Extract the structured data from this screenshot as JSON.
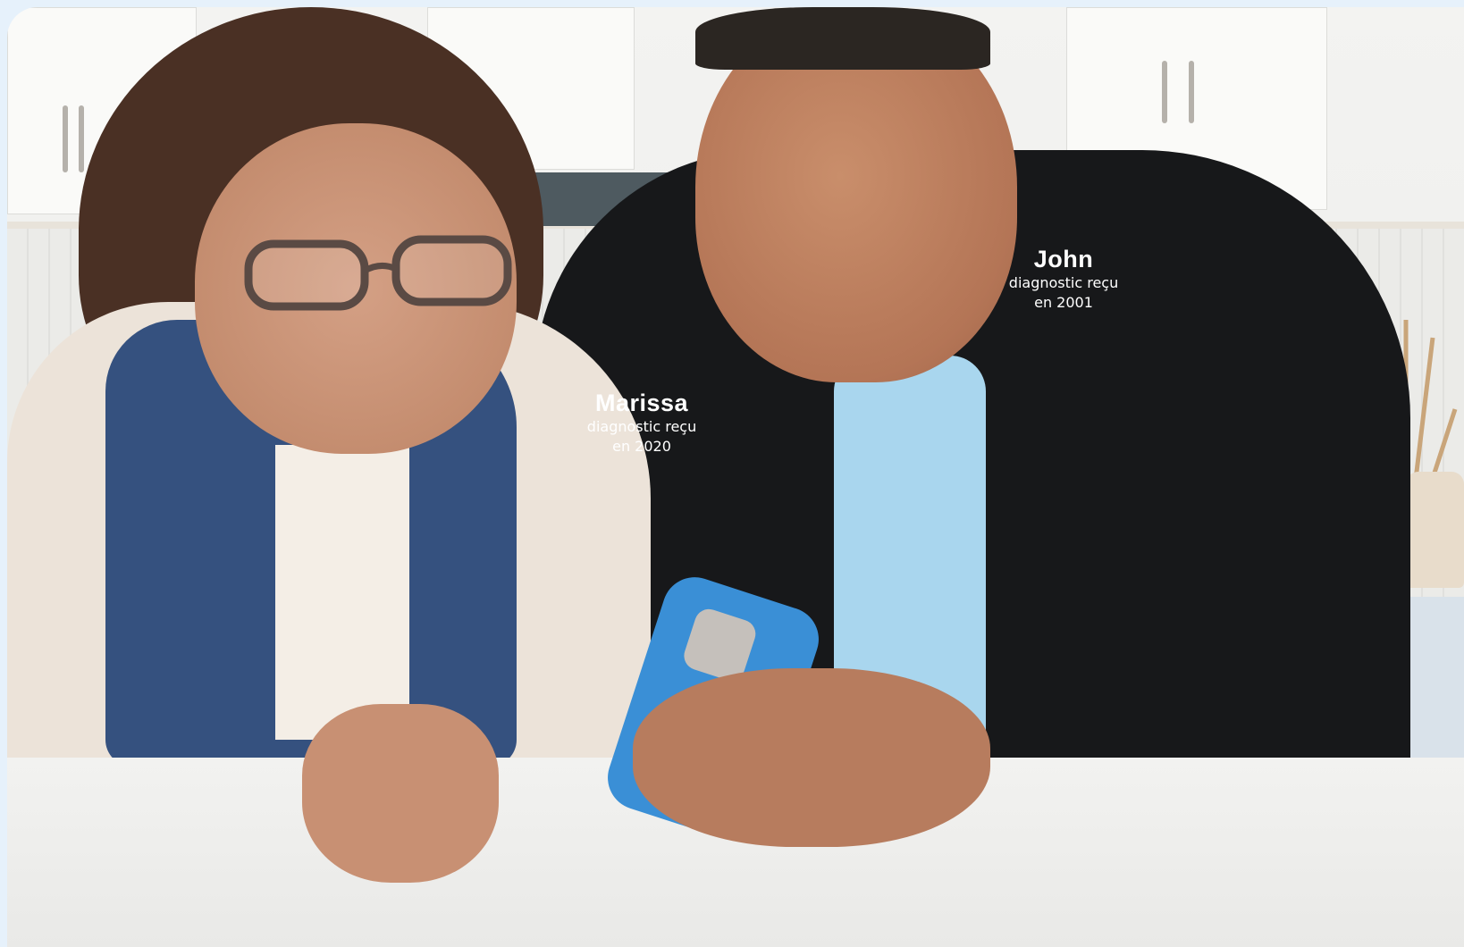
{
  "people": [
    {
      "name": "Marissa",
      "line1": "diagnostic reçu",
      "line2": "en 2020"
    },
    {
      "name": "John",
      "line1": "diagnostic reçu",
      "line2": "en 2001"
    }
  ],
  "colors": {
    "page_background": "#e6f1fb",
    "label_text": "#ffffff",
    "phone_case": "#3a8fd6",
    "jacket": "#17181a"
  },
  "scene": {
    "photo_description_icons": [
      "kitchen-background",
      "smartphone-icon",
      "glasses-icon"
    ]
  }
}
